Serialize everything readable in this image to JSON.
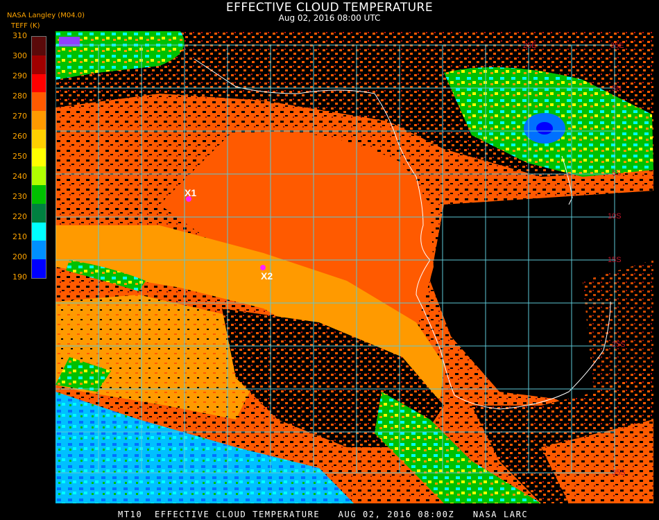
{
  "header": {
    "title": "EFFECTIVE CLOUD TEMPERATURE",
    "subtitle": "Aug 02, 2016 08:00 UTC",
    "source": "NASA Langley (M04.0)",
    "units": "TEFF (K)"
  },
  "legend": {
    "labels": [
      "310",
      "300",
      "290",
      "280",
      "270",
      "260",
      "250",
      "240",
      "230",
      "220",
      "210",
      "200",
      "190"
    ],
    "colors": [
      "#5a0a0a",
      "#a00000",
      "#ff0000",
      "#ff5a00",
      "#ff9a00",
      "#ffd000",
      "#ffff00",
      "#b0ff00",
      "#00c000",
      "#008040",
      "#00ffff",
      "#0090ff",
      "#0000ff",
      "#9040ff"
    ]
  },
  "map": {
    "grid_labels_top": [
      "25E",
      "35E"
    ],
    "grid_labels_right": [
      "5N",
      "5S",
      "10S",
      "15S",
      "25S",
      "35S"
    ],
    "stations": [
      {
        "label": "X1"
      },
      {
        "label": "X2"
      }
    ],
    "colors": {
      "ocean_dark": "#000000",
      "warm_low_cloud": "#ff5a00",
      "mid_cloud": "#ff9a00",
      "cold_cloud": "#0090ff",
      "grid": "#5ec8d6",
      "coast": "#ffffff",
      "marker": "#ff22ff"
    }
  },
  "footer": {
    "text": "MT10  EFFECTIVE CLOUD TEMPERATURE   AUG 02, 2016 08:00Z   NASA LARC"
  }
}
